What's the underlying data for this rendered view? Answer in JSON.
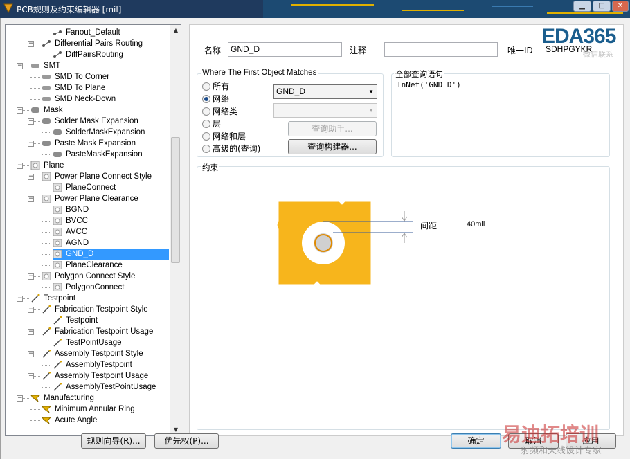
{
  "window": {
    "title": "PCB规则及约束编辑器 [mil]",
    "watermark_text": "EDA365",
    "watermark_sub": "微信联系",
    "footer_watermark": "易迪拓培训",
    "footer_watermark_sub": "射频和天线设计专家"
  },
  "tree": {
    "rows": [
      {
        "label": "Fanout_Default",
        "level": 3,
        "icon": "fanout-icon"
      },
      {
        "label": "Differential Pairs Routing",
        "level": 2,
        "icon": "diffpair-icon"
      },
      {
        "label": "DiffPairsRouting",
        "level": 3,
        "icon": "diffpair-icon"
      },
      {
        "label": "SMT",
        "level": 1,
        "icon": "smt-icon"
      },
      {
        "label": "SMD To Corner",
        "level": 2,
        "icon": "smt-icon"
      },
      {
        "label": "SMD To Plane",
        "level": 2,
        "icon": "smt-icon"
      },
      {
        "label": "SMD Neck-Down",
        "level": 2,
        "icon": "smt-icon"
      },
      {
        "label": "Mask",
        "level": 1,
        "icon": "mask-icon"
      },
      {
        "label": "Solder Mask Expansion",
        "level": 2,
        "icon": "mask-icon"
      },
      {
        "label": "SolderMaskExpansion",
        "level": 3,
        "icon": "mask-icon"
      },
      {
        "label": "Paste Mask Expansion",
        "level": 2,
        "icon": "mask-icon"
      },
      {
        "label": "PasteMaskExpansion",
        "level": 3,
        "icon": "mask-icon"
      },
      {
        "label": "Plane",
        "level": 1,
        "icon": "plane-icon"
      },
      {
        "label": "Power Plane Connect Style",
        "level": 2,
        "icon": "plane-icon"
      },
      {
        "label": "PlaneConnect",
        "level": 3,
        "icon": "plane-icon"
      },
      {
        "label": "Power Plane Clearance",
        "level": 2,
        "icon": "plane-icon"
      },
      {
        "label": "BGND",
        "level": 3,
        "icon": "plane-icon"
      },
      {
        "label": "BVCC",
        "level": 3,
        "icon": "plane-icon"
      },
      {
        "label": "AVCC",
        "level": 3,
        "icon": "plane-icon"
      },
      {
        "label": "AGND",
        "level": 3,
        "icon": "plane-icon"
      },
      {
        "label": "GND_D",
        "level": 3,
        "icon": "plane-icon",
        "selected": true
      },
      {
        "label": "PlaneClearance",
        "level": 3,
        "icon": "plane-icon"
      },
      {
        "label": "Polygon Connect Style",
        "level": 2,
        "icon": "plane-icon"
      },
      {
        "label": "PolygonConnect",
        "level": 3,
        "icon": "plane-icon"
      },
      {
        "label": "Testpoint",
        "level": 1,
        "icon": "testpoint-icon"
      },
      {
        "label": "Fabrication Testpoint Style",
        "level": 2,
        "icon": "testpoint-icon"
      },
      {
        "label": "Testpoint",
        "level": 3,
        "icon": "testpoint-icon"
      },
      {
        "label": "Fabrication Testpoint Usage",
        "level": 2,
        "icon": "testpoint-icon"
      },
      {
        "label": "TestPointUsage",
        "level": 3,
        "icon": "testpoint-icon"
      },
      {
        "label": "Assembly Testpoint Style",
        "level": 2,
        "icon": "testpoint-icon"
      },
      {
        "label": "AssemblyTestpoint",
        "level": 3,
        "icon": "testpoint-icon"
      },
      {
        "label": "Assembly Testpoint Usage",
        "level": 2,
        "icon": "testpoint-icon"
      },
      {
        "label": "AssemblyTestPointUsage",
        "level": 3,
        "icon": "testpoint-icon"
      },
      {
        "label": "Manufacturing",
        "level": 1,
        "icon": "manufacturing-icon"
      },
      {
        "label": "Minimum Annular Ring",
        "level": 2,
        "icon": "manufacturing-icon"
      },
      {
        "label": "Acute Angle",
        "level": 2,
        "icon": "manufacturing-icon"
      }
    ]
  },
  "rule": {
    "name_label": "名称",
    "name_value": "GND_D",
    "comment_label": "注释",
    "comment_value": "",
    "uid_label": "唯一ID",
    "uid_value": "SDHPGYKR"
  },
  "first_object": {
    "title": "Where The First Object Matches",
    "options": [
      "所有",
      "网络",
      "网络类",
      "层",
      "网络和层",
      "高级的(查询)"
    ],
    "selected": "网络",
    "net_combo_value": "GND_D",
    "netclass_combo_value": "",
    "query_helper_label": "查询助手...",
    "query_builder_label": "查询构建器..."
  },
  "full_query": {
    "title": "全部查询语句",
    "text": "InNet('GND_D')"
  },
  "constraints": {
    "title": "约束",
    "clearance_label": "间距",
    "clearance_value": "40mil",
    "copper_color": "#f7b51c"
  },
  "footer": {
    "rule_wizard_label": "规则向导(R)...",
    "priority_label": "优先权(P)...",
    "ok_label": "确定",
    "cancel_label": "取消",
    "apply_label": "应用"
  }
}
